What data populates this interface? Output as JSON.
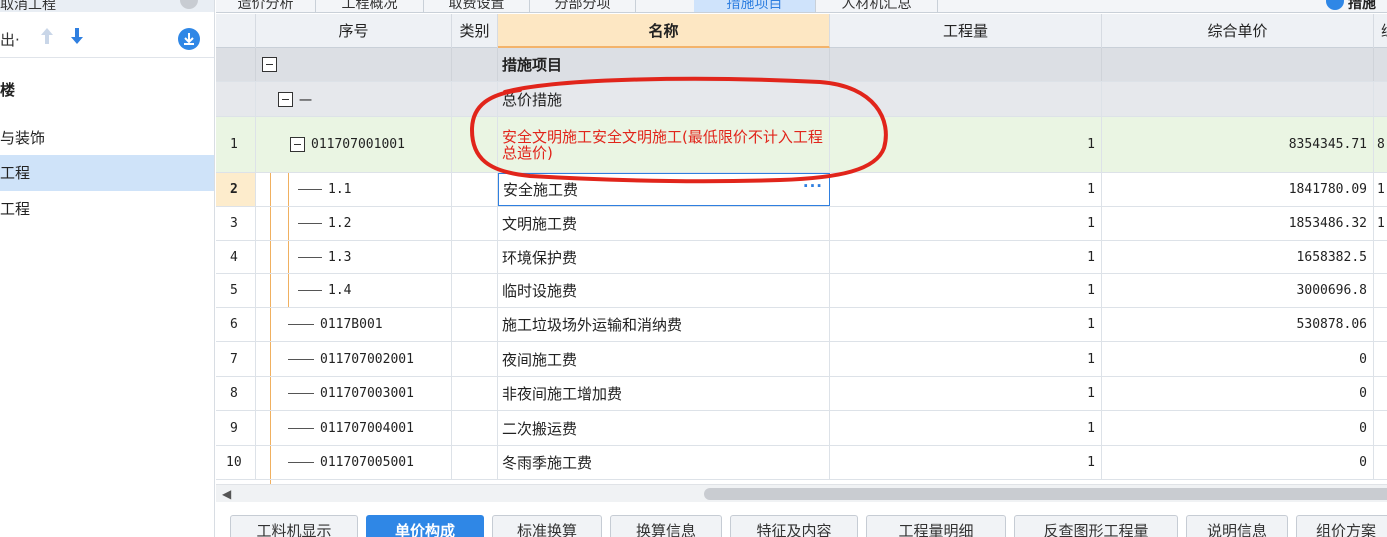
{
  "sidebar": {
    "top_partial_label": "取消工程",
    "export_label": "出·",
    "icons": [
      "arrow-up-icon",
      "arrow-down-icon",
      "download-icon"
    ],
    "items": [
      {
        "label": "楼"
      },
      {
        "label": "与装饰"
      },
      {
        "label": "工程"
      },
      {
        "label": "工程"
      }
    ]
  },
  "top_tabs": {
    "tabs": [
      {
        "label": "造价分析"
      },
      {
        "label": "工程概况"
      },
      {
        "label": "取费设置"
      },
      {
        "label": "分部分项"
      },
      {
        "label": "措施项目"
      },
      {
        "label": "人材机汇总"
      }
    ],
    "right_label": "措施"
  },
  "grid": {
    "headers": {
      "seq": "序号",
      "category": "类别",
      "name": "名称",
      "quantity": "工程量",
      "unit_price": "综合单价",
      "partial": "综"
    },
    "rows": [
      {
        "no": "",
        "code": "",
        "name": "措施项目",
        "qty": "",
        "price": "",
        "extra": ""
      },
      {
        "no": "",
        "code": "一",
        "name": "总价措施",
        "qty": "",
        "price": "",
        "extra": ""
      },
      {
        "no": "1",
        "code": "011707001001",
        "name": "安全文明施工安全文明施工(最低限价不计入工程总造价)",
        "qty": "1",
        "price": "8354345.71",
        "extra": "8"
      },
      {
        "no": "2",
        "code": "1.1",
        "name": "安全施工费",
        "qty": "1",
        "price": "1841780.09",
        "extra": "1"
      },
      {
        "no": "3",
        "code": "1.2",
        "name": "文明施工费",
        "qty": "1",
        "price": "1853486.32",
        "extra": "1"
      },
      {
        "no": "4",
        "code": "1.3",
        "name": "环境保护费",
        "qty": "1",
        "price": "1658382.5",
        "extra": ""
      },
      {
        "no": "5",
        "code": "1.4",
        "name": "临时设施费",
        "qty": "1",
        "price": "3000696.8",
        "extra": ""
      },
      {
        "no": "6",
        "code": "0117B001",
        "name": "施工垃圾场外运输和消纳费",
        "qty": "1",
        "price": "530878.06",
        "extra": ""
      },
      {
        "no": "7",
        "code": "011707002001",
        "name": "夜间施工费",
        "qty": "1",
        "price": "0",
        "extra": ""
      },
      {
        "no": "8",
        "code": "011707003001",
        "name": "非夜间施工增加费",
        "qty": "1",
        "price": "0",
        "extra": ""
      },
      {
        "no": "9",
        "code": "011707004001",
        "name": "二次搬运费",
        "qty": "1",
        "price": "0",
        "extra": ""
      },
      {
        "no": "10",
        "code": "011707005001",
        "name": "冬雨季施工费",
        "qty": "1",
        "price": "0",
        "extra": ""
      }
    ]
  },
  "bottom_tabs": [
    {
      "label": "工料机显示"
    },
    {
      "label": "单价构成"
    },
    {
      "label": "标准换算"
    },
    {
      "label": "换算信息"
    },
    {
      "label": "特征及内容"
    },
    {
      "label": "工程量明细"
    },
    {
      "label": "反查图形工程量"
    },
    {
      "label": "说明信息"
    },
    {
      "label": "组价方案"
    }
  ],
  "colors": {
    "accent": "#2f87e6",
    "annotation_red": "#e1251b",
    "selected_row": "#eaf5e3",
    "name_header": "#fde7c3"
  }
}
